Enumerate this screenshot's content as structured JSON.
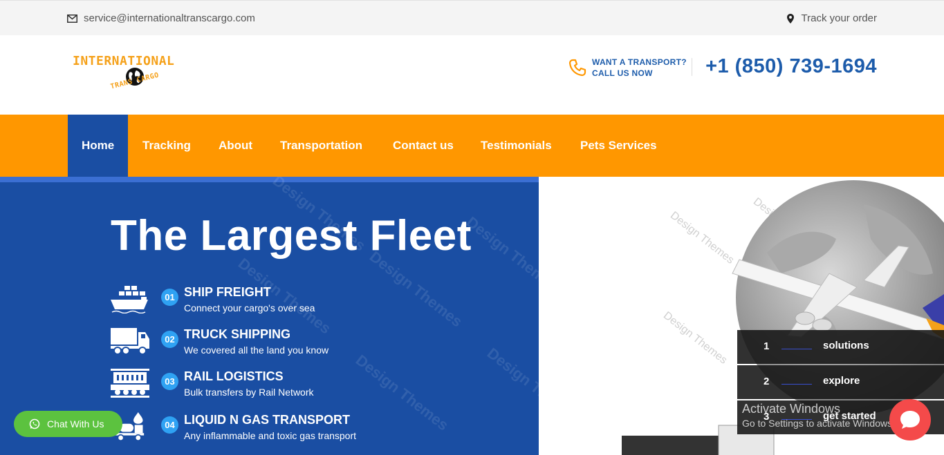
{
  "topbar": {
    "email": "service@internationaltranscargo.com",
    "track": "Track your order"
  },
  "header": {
    "logo_line1": "INTERNATIONAL",
    "logo_line2": "TRANS CARGO",
    "want_line1": "WANT A TRANSPORT?",
    "want_line2": "CALL US NOW",
    "phone": "+1 (850) 739-1694"
  },
  "nav": {
    "items": [
      {
        "label": "Home",
        "active": true
      },
      {
        "label": "Tracking"
      },
      {
        "label": "About"
      },
      {
        "label": "Transportation"
      },
      {
        "label": "Contact us"
      },
      {
        "label": "Testimonials"
      },
      {
        "label": "Pets Services"
      }
    ]
  },
  "hero": {
    "title": "The Largest Fleet",
    "watermark": "Design Themes",
    "features": [
      {
        "num": "01",
        "title": "SHIP FREIGHT",
        "subtitle": "Connect your cargo's over sea",
        "icon": "ship-icon"
      },
      {
        "num": "02",
        "title": "TRUCK SHIPPING",
        "subtitle": "We covered all the land you know",
        "icon": "truck-icon"
      },
      {
        "num": "03",
        "title": "RAIL LOGISTICS",
        "subtitle": "Bulk transfers by Rail Network",
        "icon": "train-icon"
      },
      {
        "num": "04",
        "title": "LIQUID N GAS TRANSPORT",
        "subtitle": "Any inflammable and toxic gas transport",
        "icon": "gas-truck-icon"
      }
    ]
  },
  "steps": [
    {
      "num": "1",
      "label": "solutions"
    },
    {
      "num": "2",
      "label": "explore"
    },
    {
      "num": "3",
      "label": "get started"
    }
  ],
  "activate": {
    "line1": "Activate Windows",
    "line2": "Go to Settings to activate Windows."
  },
  "chat": {
    "label": "Chat With Us"
  },
  "colors": {
    "orange": "#ff9700",
    "blue": "#1a4ea3",
    "accent_blue": "#1d5cab",
    "badge": "#2fa2f3",
    "chat_green": "#5cc23f",
    "bubble_red": "#f44a4a"
  }
}
